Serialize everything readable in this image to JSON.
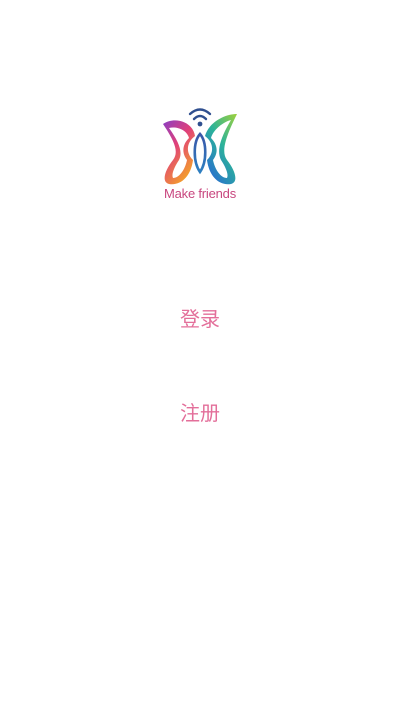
{
  "brand": {
    "tagline": "Make friends",
    "logo_icon": "butterfly-wifi-logo",
    "colors": {
      "text": "#c8477f",
      "wifi": "#2f4f8f",
      "gradient": [
        "#b93bb0",
        "#e0407a",
        "#f08a2a",
        "#7cc242",
        "#2a8fcf"
      ]
    }
  },
  "actions": {
    "login_label": "登录",
    "register_label": "注册",
    "color": "#e36f9a"
  }
}
